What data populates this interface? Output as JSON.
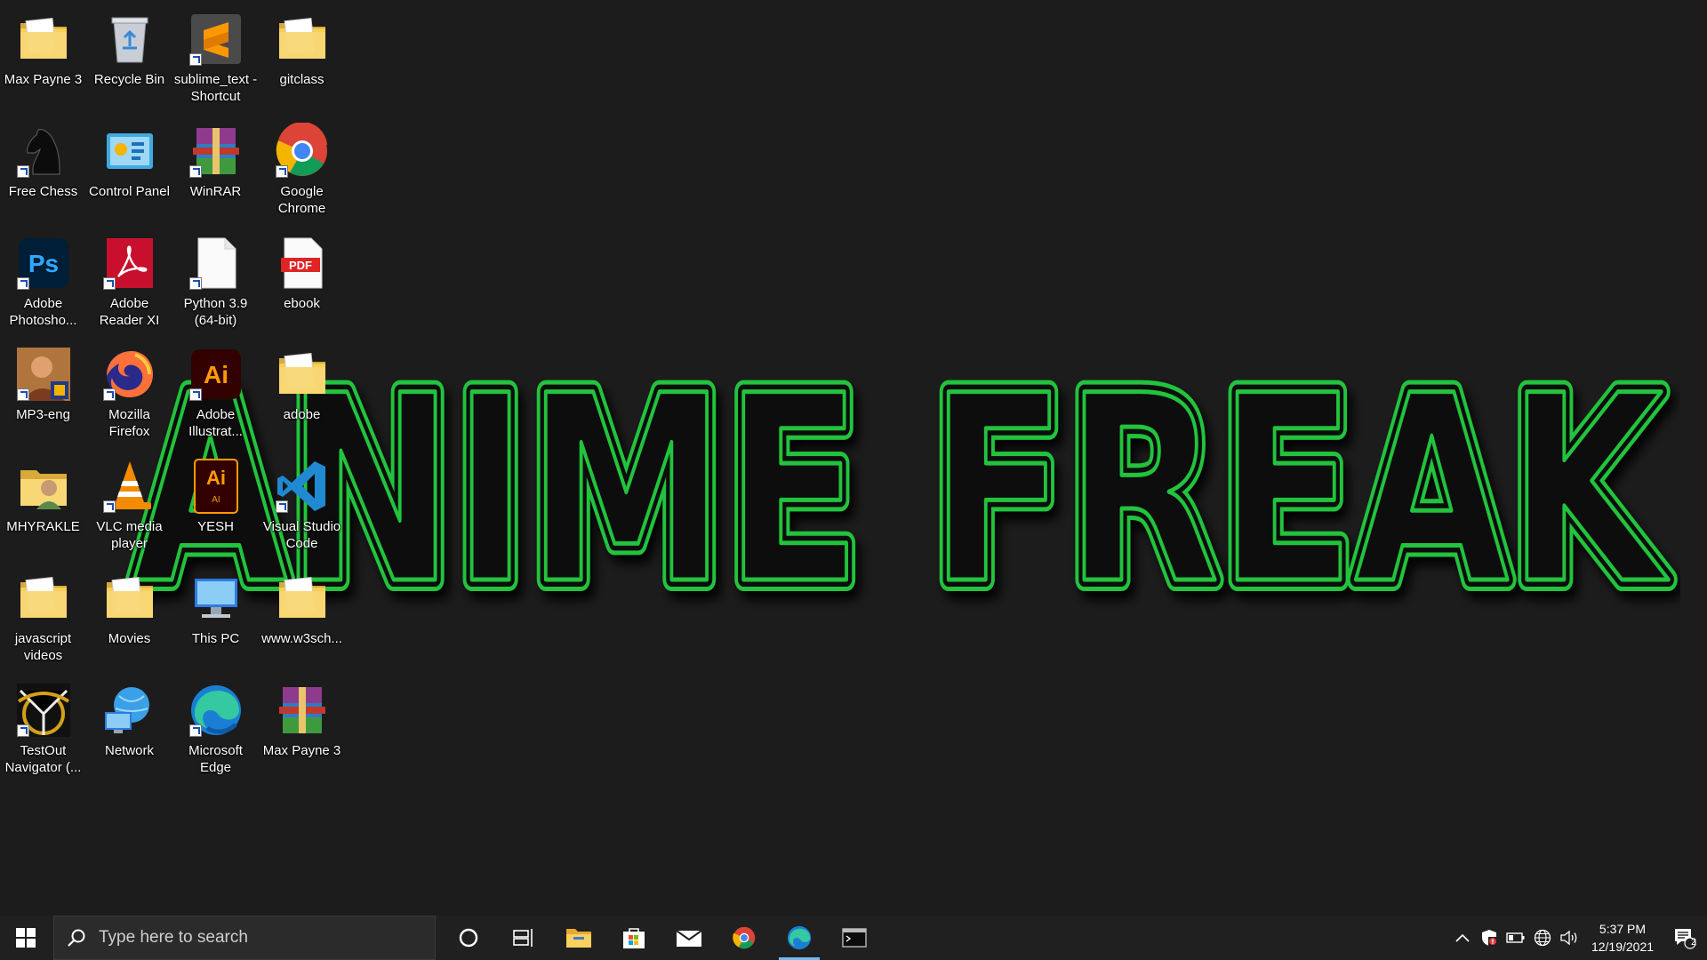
{
  "wallpaper": {
    "text": "ANIME FREAK",
    "color": "#22c33c"
  },
  "desktop_icons": [
    {
      "id": "maxpayne3-folder",
      "label": "Max Payne 3",
      "icon": "folder-icon"
    },
    {
      "id": "recycle-bin",
      "label": "Recycle Bin",
      "icon": "recycle-bin-icon"
    },
    {
      "id": "sublime",
      "label": "sublime_text - Shortcut",
      "icon": "sublime-text-icon"
    },
    {
      "id": "gitclass",
      "label": "gitclass",
      "icon": "folder-icon"
    },
    {
      "id": "free-chess",
      "label": "Free Chess",
      "icon": "chess-knight-icon"
    },
    {
      "id": "control-panel",
      "label": "Control Panel",
      "icon": "control-panel-icon"
    },
    {
      "id": "winrar",
      "label": "WinRAR",
      "icon": "winrar-icon"
    },
    {
      "id": "google-chrome",
      "label": "Google Chrome",
      "icon": "chrome-icon"
    },
    {
      "id": "photoshop",
      "label": "Adobe Photosho...",
      "icon": "photoshop-icon"
    },
    {
      "id": "adobe-reader",
      "label": "Adobe Reader XI",
      "icon": "acrobat-icon"
    },
    {
      "id": "python",
      "label": "Python 3.9 (64-bit)",
      "icon": "file-icon"
    },
    {
      "id": "ebook",
      "label": "ebook",
      "icon": "pdf-icon"
    },
    {
      "id": "mp3-eng",
      "label": "MP3-eng",
      "icon": "image-thumbnail-icon"
    },
    {
      "id": "firefox",
      "label": "Mozilla Firefox",
      "icon": "firefox-icon"
    },
    {
      "id": "illustrator",
      "label": "Adobe Illustrat...",
      "icon": "illustrator-icon"
    },
    {
      "id": "adobe-folder",
      "label": "adobe",
      "icon": "folder-icon"
    },
    {
      "id": "mhyrakle",
      "label": "MHYRAKLE",
      "icon": "user-folder-icon"
    },
    {
      "id": "vlc",
      "label": "VLC media player",
      "icon": "vlc-icon"
    },
    {
      "id": "yesh",
      "label": "YESH",
      "icon": "ai-file-icon"
    },
    {
      "id": "vscode",
      "label": "Visual Studio Code",
      "icon": "vscode-icon"
    },
    {
      "id": "js-videos",
      "label": "javascript videos",
      "icon": "folder-icon"
    },
    {
      "id": "movies",
      "label": "Movies",
      "icon": "folder-icon"
    },
    {
      "id": "this-pc",
      "label": "This PC",
      "icon": "computer-icon"
    },
    {
      "id": "w3schools",
      "label": "www.w3sch...",
      "icon": "folder-icon"
    },
    {
      "id": "testout",
      "label": "TestOut Navigator (...",
      "icon": "testout-icon"
    },
    {
      "id": "network",
      "label": "Network",
      "icon": "network-icon"
    },
    {
      "id": "edge",
      "label": "Microsoft Edge",
      "icon": "edge-icon"
    },
    {
      "id": "maxpayne3-rar",
      "label": "Max Payne 3",
      "icon": "winrar-icon"
    }
  ],
  "taskbar": {
    "search_placeholder": "Type here to search",
    "apps": [
      "cortana-icon",
      "task-view-icon",
      "file-explorer-icon",
      "store-icon",
      "mail-icon",
      "chrome-icon",
      "edge-icon",
      "terminal-icon"
    ],
    "active_app": "edge-icon",
    "clock_time": "5:37 PM",
    "clock_date": "12/19/2021",
    "notification_count": "2"
  }
}
